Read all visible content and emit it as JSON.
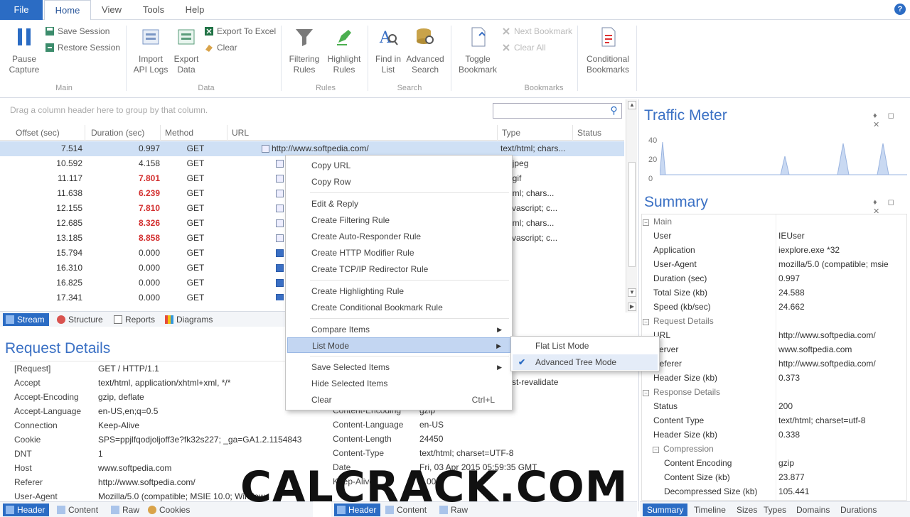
{
  "menu": {
    "file": "File",
    "home": "Home",
    "view": "View",
    "tools": "Tools",
    "help": "Help",
    "help_icon": "?"
  },
  "ribbon": {
    "pause_capture": "Pause\nCapture",
    "save_session": "Save Session",
    "restore_session": "Restore Session",
    "main_group": "Main",
    "import_api_logs": "Import\nAPI Logs",
    "export_data": "Export\nData",
    "export_to_excel": "Export To Excel",
    "clear": "Clear",
    "data_group": "Data",
    "filtering_rules": "Filtering\nRules",
    "highlight_rules": "Highlight\nRules",
    "rules_group": "Rules",
    "find_in_list": "Find in\nList",
    "advanced_search": "Advanced\nSearch",
    "search_group": "Search",
    "toggle_bookmark": "Toggle\nBookmark",
    "next_bookmark": "Next Bookmark",
    "clear_all": "Clear All",
    "conditional_bookmarks": "Conditional\nBookmarks",
    "bookmarks_group": "Bookmarks"
  },
  "grid": {
    "group_hint": "Drag a column header here to group by that column.",
    "columns": [
      "Offset (sec)",
      "Duration (sec)",
      "Method",
      "URL",
      "Type",
      "Status"
    ],
    "rows": [
      {
        "offset": "7.514",
        "duration": "0.997",
        "method": "GET",
        "url": "http://www.softpedia.com/",
        "type": "text/html; chars..."
      },
      {
        "offset": "10.592",
        "duration": "4.158",
        "method": "GET",
        "url": "",
        "type": "ge/jpeg"
      },
      {
        "offset": "11.117",
        "duration": "7.801",
        "method": "GET",
        "url": "",
        "type": "ge/gif"
      },
      {
        "offset": "11.638",
        "duration": "6.239",
        "method": "GET",
        "url": "",
        "type": "t/html; chars..."
      },
      {
        "offset": "12.155",
        "duration": "7.810",
        "method": "GET",
        "url": "",
        "type": "t/javascript; c..."
      },
      {
        "offset": "12.685",
        "duration": "8.326",
        "method": "GET",
        "url": "",
        "type": "t/html; chars..."
      },
      {
        "offset": "13.185",
        "duration": "8.858",
        "method": "GET",
        "url": "",
        "type": "t/javascript; c..."
      },
      {
        "offset": "15.794",
        "duration": "0.000",
        "method": "GET",
        "url": "",
        "type": ""
      },
      {
        "offset": "16.310",
        "duration": "0.000",
        "method": "GET",
        "url": "",
        "type": ""
      },
      {
        "offset": "16.825",
        "duration": "0.000",
        "method": "GET",
        "url": "",
        "type": ""
      },
      {
        "offset": "17.341",
        "duration": "0.000",
        "method": "GET",
        "url": "",
        "type": ""
      }
    ]
  },
  "view_tabs": [
    "Stream",
    "Structure",
    "Reports",
    "Diagrams"
  ],
  "request": {
    "title": "Request Details",
    "rows": [
      {
        "k": "[Request]",
        "v": "GET / HTTP/1.1"
      },
      {
        "k": "Accept",
        "v": "text/html, application/xhtml+xml, */*"
      },
      {
        "k": "Accept-Encoding",
        "v": "gzip, deflate"
      },
      {
        "k": "Accept-Language",
        "v": "en-US,en;q=0.5"
      },
      {
        "k": "Connection",
        "v": "Keep-Alive"
      },
      {
        "k": "Cookie",
        "v": "SPS=ppjlfqodjoljoff3e?fk32s227; _ga=GA1.2.1154843"
      },
      {
        "k": "DNT",
        "v": "1"
      },
      {
        "k": "Host",
        "v": "www.softpedia.com"
      },
      {
        "k": "Referer",
        "v": "http://www.softpedia.com/"
      },
      {
        "k": "User-Agent",
        "v": "Mozilla/5.0 (compatible; MSIE 10.0; Windows"
      }
    ],
    "tabs": [
      "Header",
      "Content",
      "Raw",
      "Cookies"
    ]
  },
  "response": {
    "revalidate": "st-revalidate",
    "rows": [
      {
        "k": "Content-Encoding",
        "v": "gzip"
      },
      {
        "k": "Content-Language",
        "v": "en-US"
      },
      {
        "k": "Content-Length",
        "v": "24450"
      },
      {
        "k": "Content-Type",
        "v": "text/html; charset=UTF-8"
      },
      {
        "k": "Date",
        "v": "Fri, 03 Apr 2015 05:59:35 GMT"
      },
      {
        "k": "Keep-Alive",
        "v": "...000"
      }
    ],
    "tabs": [
      "Header",
      "Content",
      "Raw"
    ]
  },
  "traffic": {
    "title": "Traffic Meter",
    "y_labels": [
      "40",
      "20",
      "0"
    ],
    "controls": "♦ ◻ ✕"
  },
  "summary": {
    "title": "Summary",
    "controls": "♦ ◻ ✕",
    "main_label": "Main",
    "main": [
      {
        "k": "User",
        "v": "IEUser"
      },
      {
        "k": "Application",
        "v": "iexplore.exe *32"
      },
      {
        "k": "User-Agent",
        "v": "mozilla/5.0 (compatible; msie"
      },
      {
        "k": "Duration (sec)",
        "v": "0.997"
      },
      {
        "k": "Total Size (kb)",
        "v": "24.588"
      },
      {
        "k": "Speed (kb/sec)",
        "v": "24.662"
      }
    ],
    "request_label": "Request Details",
    "request": [
      {
        "k": "URL",
        "v": "http://www.softpedia.com/"
      },
      {
        "k": "Server",
        "v": "www.softpedia.com"
      },
      {
        "k": "Referer",
        "v": "http://www.softpedia.com/"
      },
      {
        "k": "Header Size (kb)",
        "v": "0.373"
      }
    ],
    "response_label": "Response Details",
    "response": [
      {
        "k": "Status",
        "v": "200"
      },
      {
        "k": "Content Type",
        "v": "text/html; charset=utf-8"
      },
      {
        "k": "Header Size (kb)",
        "v": "0.338"
      }
    ],
    "compression_label": "Compression",
    "compression": [
      {
        "k": "Content Encoding",
        "v": "gzip"
      },
      {
        "k": "Content Size (kb)",
        "v": "23.877"
      },
      {
        "k": "Decompressed Size (kb)",
        "v": "105.441"
      }
    ],
    "tabs": [
      "Summary",
      "Timeline",
      "Sizes",
      "Types",
      "Domains",
      "Durations"
    ]
  },
  "context_menu": {
    "items": [
      "Copy URL",
      "Copy Row",
      "Edit & Reply",
      "Create Filtering Rule",
      "Create Auto-Responder Rule",
      "Create HTTP Modifier Rule",
      "Create TCP/IP Redirector Rule",
      "Create Highlighting Rule",
      "Create Conditional Bookmark Rule",
      "Compare Items",
      "List Mode",
      "Save Selected Items",
      "Hide Selected Items",
      "Clear"
    ],
    "clear_shortcut": "Ctrl+L",
    "submenu": [
      "Flat List Mode",
      "Advanced Tree Mode"
    ]
  },
  "watermark": "CALCRACK.COM"
}
